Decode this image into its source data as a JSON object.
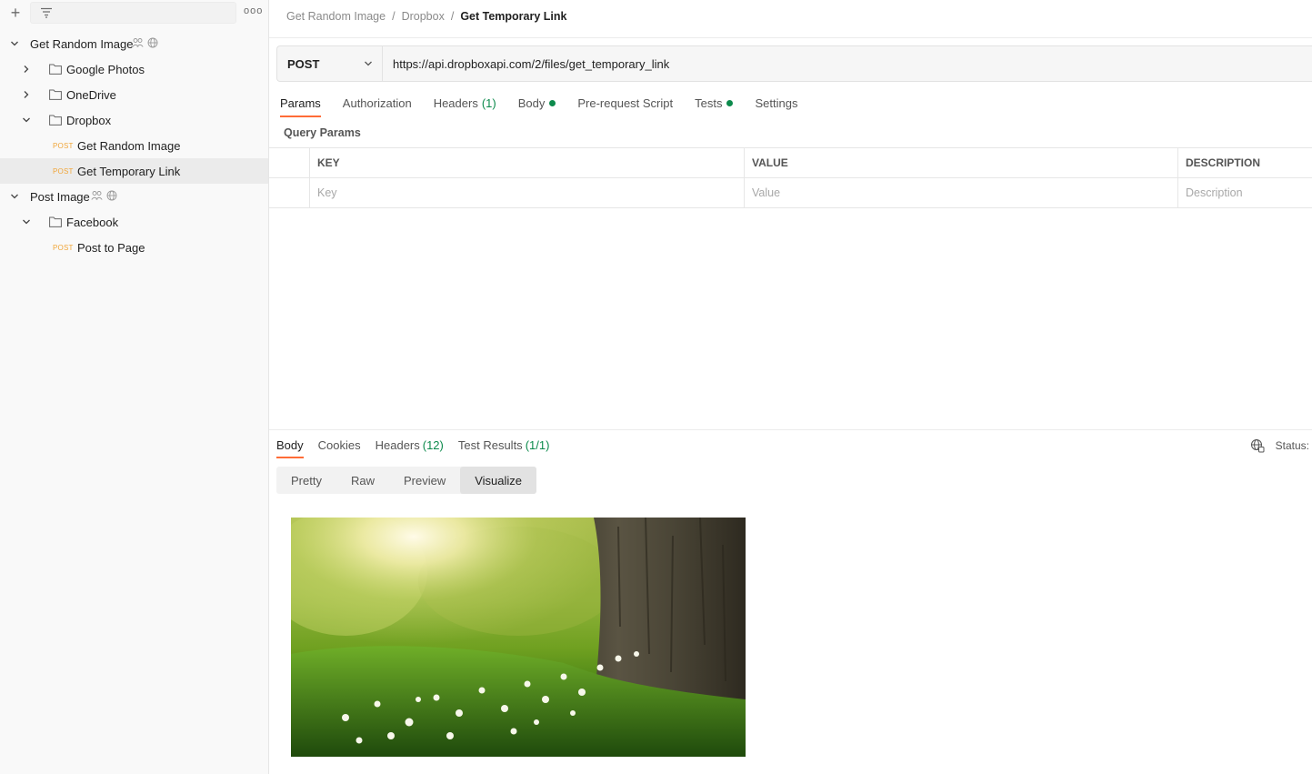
{
  "sidebar": {
    "filter_placeholder": "",
    "tree": [
      {
        "type": "collection",
        "label": "Get Random Image",
        "expanded": true
      },
      {
        "type": "folder",
        "label": "Google Photos",
        "expanded": false
      },
      {
        "type": "folder",
        "label": "OneDrive",
        "expanded": false
      },
      {
        "type": "folder",
        "label": "Dropbox",
        "expanded": true
      },
      {
        "type": "request",
        "method": "POST",
        "label": "Get Random Image"
      },
      {
        "type": "request",
        "method": "POST",
        "label": "Get Temporary Link",
        "selected": true
      },
      {
        "type": "collection",
        "label": "Post Image",
        "expanded": true
      },
      {
        "type": "folder",
        "label": "Facebook",
        "expanded": true
      },
      {
        "type": "request",
        "method": "POST",
        "label": "Post to Page"
      }
    ]
  },
  "breadcrumb": {
    "items": [
      "Get Random Image",
      "/",
      "Dropbox",
      "/"
    ],
    "current": "Get Temporary Link"
  },
  "request": {
    "method": "POST",
    "url": "https://api.dropboxapi.com/2/files/get_temporary_link"
  },
  "request_tabs": {
    "params": "Params",
    "authorization": "Authorization",
    "headers": "Headers",
    "headers_count": "(1)",
    "body": "Body",
    "prerequest": "Pre-request Script",
    "tests": "Tests",
    "settings": "Settings"
  },
  "query_params": {
    "title": "Query Params",
    "headers": [
      "KEY",
      "VALUE",
      "DESCRIPTION"
    ],
    "placeholders": [
      "Key",
      "Value",
      "Description"
    ]
  },
  "response_tabs": {
    "body": "Body",
    "cookies": "Cookies",
    "headers": "Headers",
    "headers_count": "(12)",
    "test_results": "Test Results",
    "test_results_count": "(1/1)"
  },
  "status": {
    "label": "Status:"
  },
  "view_modes": [
    "Pretty",
    "Raw",
    "Preview",
    "Visualize"
  ],
  "active_view_mode": "Visualize",
  "colors": {
    "accent": "#ff6c37",
    "post_method": "#f0a63a",
    "success_green": "#0c8a4c"
  }
}
